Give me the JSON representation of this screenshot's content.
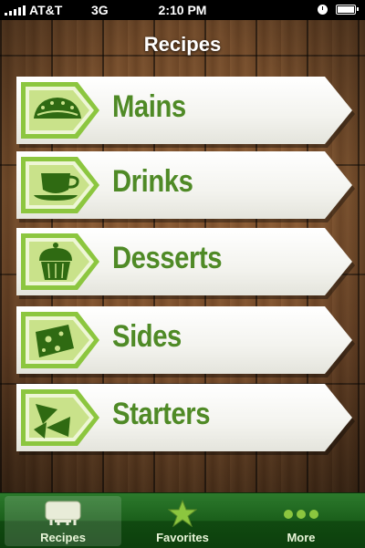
{
  "status_bar": {
    "carrier": "AT&T",
    "network": "3G",
    "time": "2:10 PM"
  },
  "nav": {
    "title": "Recipes"
  },
  "categories": [
    {
      "label": "Mains",
      "icon": "taco-icon"
    },
    {
      "label": "Drinks",
      "icon": "teacup-icon"
    },
    {
      "label": "Desserts",
      "icon": "cupcake-icon"
    },
    {
      "label": "Sides",
      "icon": "cheese-icon"
    },
    {
      "label": "Starters",
      "icon": "nachos-icon"
    }
  ],
  "tabbar": {
    "tabs": [
      {
        "label": "Recipes",
        "icon": "recipes-icon",
        "active": true
      },
      {
        "label": "Favorites",
        "icon": "star-icon",
        "active": false
      },
      {
        "label": "More",
        "icon": "more-icon",
        "active": false
      }
    ]
  },
  "colors": {
    "accent_green": "#4f8a26",
    "badge_green": "#8cc63f",
    "tabbar_green": "#1b5f1b"
  }
}
